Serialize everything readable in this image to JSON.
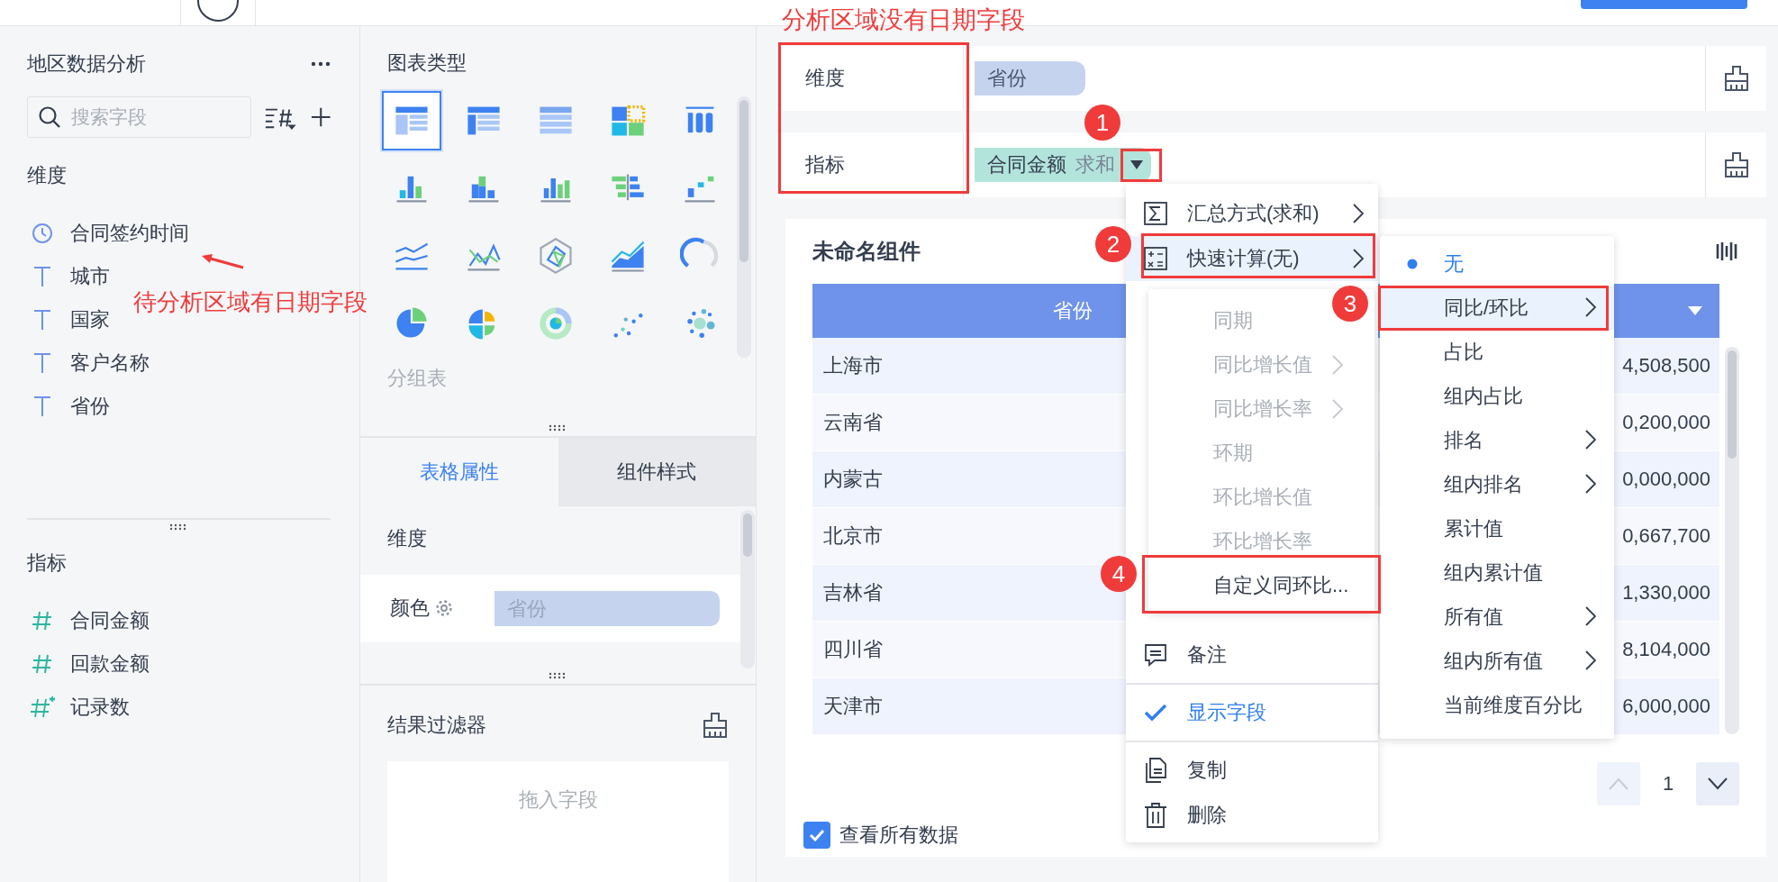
{
  "field_panel": {
    "title": "地区数据分析",
    "search": {
      "placeholder": "搜索字段"
    },
    "sections": [
      {
        "label": "维度",
        "fields": [
          {
            "kind": "date",
            "name": "合同签约时间"
          },
          {
            "kind": "text",
            "name": "城市"
          },
          {
            "kind": "text",
            "name": "国家"
          },
          {
            "kind": "text",
            "name": "客户名称"
          },
          {
            "kind": "text",
            "name": "省份"
          }
        ]
      },
      {
        "label": "指标",
        "fields": [
          {
            "kind": "number",
            "name": "合同金额"
          },
          {
            "kind": "number",
            "name": "回款金额"
          },
          {
            "kind": "count",
            "name": "记录数"
          }
        ]
      }
    ]
  },
  "chart_panel": {
    "title": "图表类型",
    "chart_types": [
      {
        "kind": "table",
        "selected": true
      },
      {
        "kind": "crosstable",
        "selected": false
      },
      {
        "kind": "gridtable",
        "selected": false
      },
      {
        "kind": "heatmap",
        "selected": false
      },
      {
        "kind": "kpi",
        "selected": false
      },
      {
        "kind": "stackbar",
        "selected": false
      },
      {
        "kind": "stackcolumn",
        "selected": false
      },
      {
        "kind": "column",
        "selected": false
      },
      {
        "kind": "compare",
        "selected": false
      },
      {
        "kind": "range",
        "selected": false
      },
      {
        "kind": "line",
        "selected": false
      },
      {
        "kind": "combo",
        "selected": false
      },
      {
        "kind": "radar",
        "selected": false
      },
      {
        "kind": "area",
        "selected": false
      },
      {
        "kind": "gauge",
        "selected": false
      },
      {
        "kind": "pie",
        "selected": false
      },
      {
        "kind": "rose",
        "selected": false
      },
      {
        "kind": "donut",
        "selected": false
      },
      {
        "kind": "scatter",
        "selected": false
      },
      {
        "kind": "bubble",
        "selected": false
      }
    ],
    "hint": "分组表"
  },
  "property_tabs": [
    {
      "label": "表格属性",
      "selected": true
    },
    {
      "label": "组件样式",
      "selected": false
    }
  ],
  "properties": {
    "section": "维度",
    "rows": [
      {
        "label": "颜色",
        "field": "省份"
      }
    ]
  },
  "result_filter": {
    "title": "结果过滤器",
    "placeholder": "拖入字段"
  },
  "analysis": {
    "rows": [
      {
        "label": "维度",
        "fields": [
          {
            "kind": "dimension",
            "name": "省份"
          }
        ]
      },
      {
        "label": "指标",
        "fields": [
          {
            "kind": "measure",
            "name": "合同金额",
            "aggregation": "求和"
          }
        ]
      }
    ]
  },
  "component": {
    "title": "未命名组件",
    "table": {
      "columns": [
        "省份"
      ],
      "rows": [
        [
          "上海市",
          "4,508,500"
        ],
        [
          "云南省",
          "0,200,000"
        ],
        [
          "内蒙古",
          "0,000,000"
        ],
        [
          "北京市",
          "0,667,700"
        ],
        [
          "吉林省",
          "1,330,000"
        ],
        [
          "四川省",
          "8,104,000"
        ],
        [
          "天津市",
          "6,000,000"
        ]
      ]
    },
    "pagination": {
      "page": "1",
      "prev_disabled": true
    },
    "show_all": {
      "label": "查看所有数据",
      "checked": true
    }
  },
  "field_menu": {
    "groups": [
      [
        {
          "kind": "sigma",
          "label": "汇总方式(求和)",
          "submenu": true,
          "highlighted": false,
          "checked": false
        },
        {
          "kind": "calc",
          "label": "快速计算(无)",
          "submenu": true,
          "highlighted": true,
          "checked": false
        }
      ],
      [
        {
          "kind": "note",
          "label": "备注",
          "submenu": false,
          "highlighted": false,
          "checked": false
        }
      ],
      [
        {
          "kind": "check",
          "label": "显示字段",
          "submenu": false,
          "highlighted": false,
          "checked": true
        }
      ],
      [
        {
          "kind": "copy",
          "label": "复制",
          "submenu": false,
          "highlighted": false,
          "checked": false
        },
        {
          "kind": "delete",
          "label": "删除",
          "submenu": false,
          "highlighted": false,
          "checked": false
        }
      ]
    ]
  },
  "quick_calc_menu": {
    "items": [
      {
        "label": "无",
        "submenu": false,
        "selected": true,
        "highlighted": false
      },
      {
        "label": "同比/环比",
        "submenu": true,
        "selected": false,
        "highlighted": true
      },
      {
        "label": "占比",
        "submenu": false,
        "selected": false,
        "highlighted": false
      },
      {
        "label": "组内占比",
        "submenu": false,
        "selected": false,
        "highlighted": false
      },
      {
        "label": "排名",
        "submenu": true,
        "selected": false,
        "highlighted": false
      },
      {
        "label": "组内排名",
        "submenu": true,
        "selected": false,
        "highlighted": false
      },
      {
        "label": "累计值",
        "submenu": false,
        "selected": false,
        "highlighted": false
      },
      {
        "label": "组内累计值",
        "submenu": false,
        "selected": false,
        "highlighted": false
      },
      {
        "label": "所有值",
        "submenu": true,
        "selected": false,
        "highlighted": false
      },
      {
        "label": "组内所有值",
        "submenu": true,
        "selected": false,
        "highlighted": false
      },
      {
        "label": "当前维度百分比",
        "submenu": false,
        "selected": false,
        "highlighted": false
      }
    ]
  },
  "compare_menu": {
    "items": [
      {
        "label": "同期",
        "submenu": false,
        "disabled": true
      },
      {
        "label": "同比增长值",
        "submenu": true,
        "disabled": true
      },
      {
        "label": "同比增长率",
        "submenu": true,
        "disabled": true
      },
      {
        "label": "环期",
        "submenu": false,
        "disabled": true
      },
      {
        "label": "环比增长值",
        "submenu": false,
        "disabled": true
      },
      {
        "label": "环比增长率",
        "submenu": false,
        "disabled": true
      },
      {
        "label": "自定义同环比...",
        "submenu": false,
        "disabled": false
      }
    ]
  },
  "annotations": {
    "notes": [
      "分析区域没有日期字段",
      "待分析区域有日期字段"
    ],
    "markers": [
      "1",
      "2",
      "3",
      "4"
    ]
  }
}
